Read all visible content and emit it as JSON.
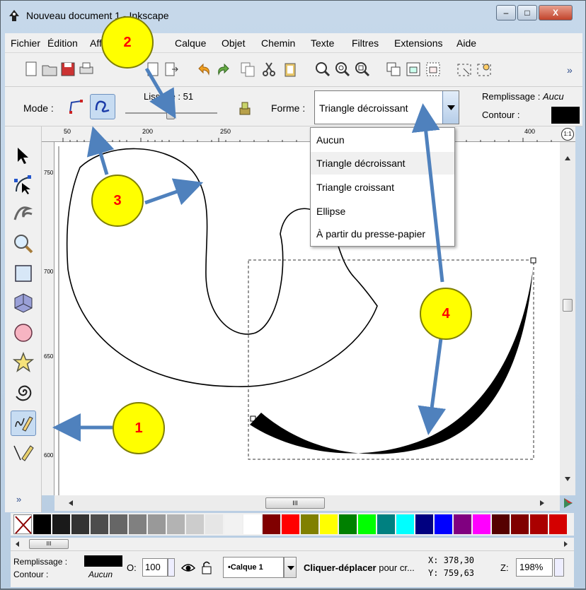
{
  "window": {
    "title": "Nouveau document 1 - Inkscape",
    "controls": {
      "minimize": "‒",
      "maximize": "□",
      "close": "X"
    }
  },
  "menubar": [
    "Fichier",
    "Édition",
    "Affichage",
    "Calque",
    "Objet",
    "Chemin",
    "Texte",
    "Filtres",
    "Extensions",
    "Aide"
  ],
  "command_toolbar": {
    "icons": [
      "new-document-icon",
      "open-icon",
      "save-icon",
      "print-icon",
      "import-icon",
      "export-icon",
      "undo-icon",
      "redo-icon",
      "copy-icon",
      "cut-icon",
      "paste-icon",
      "zoom-selection-icon",
      "zoom-drawing-icon",
      "zoom-page-icon",
      "duplicate-icon",
      "group-icon",
      "ungroup-icon",
      "fill-stroke-icon",
      "preferences-icon"
    ],
    "overflow": "»"
  },
  "controls_bar": {
    "mode_label": "Mode :",
    "smoothing_label": "Lissage : 51",
    "smoothing_value": 51,
    "shape_label": "Forme :",
    "shape_selected": "Triangle décroissant",
    "fill_label": "Remplissage :",
    "fill_value": "Aucu",
    "stroke_label": "Contour :",
    "stroke_color": "#000000"
  },
  "shape_dropdown": {
    "options": [
      "Aucun",
      "Triangle décroissant",
      "Triangle croissant",
      "Ellipse",
      "À partir du presse-papier"
    ],
    "highlighted_index": 1
  },
  "ruler": {
    "top_ticks": [
      "50",
      "200",
      "250",
      "400"
    ],
    "left_ticks": [
      "750",
      "700",
      "650",
      "600"
    ]
  },
  "toolbox": [
    "selector-icon",
    "node-editor-icon",
    "tweak-icon",
    "zoom-icon",
    "rectangle-icon",
    "3d-box-icon",
    "ellipse-icon",
    "star-icon",
    "spiral-icon",
    "pencil-icon",
    "pen-icon"
  ],
  "toolbox_overflow": "»",
  "palette": {
    "colors": [
      "#000000",
      "#1a1a1a",
      "#333333",
      "#4d4d4d",
      "#666666",
      "#808080",
      "#999999",
      "#b3b3b3",
      "#cccccc",
      "#e6e6e6",
      "#f2f2f2",
      "#ffffff",
      "#800000",
      "#ff0000",
      "#808000",
      "#ffff00",
      "#008000",
      "#00ff00",
      "#008080",
      "#00ffff",
      "#000080",
      "#0000ff",
      "#800080",
      "#ff00ff",
      "#550000",
      "#800000",
      "#aa0000",
      "#d40000"
    ]
  },
  "statusbar": {
    "fill_label": "Remplissage :",
    "stroke_label": "Contour :",
    "stroke_value": "Aucun",
    "opacity_label": "O:",
    "opacity_value": "100",
    "layer_name": "•Calque 1",
    "message_bold": "Cliquer-déplacer",
    "message_rest": "pour cr...",
    "coord_x_label": "X:",
    "coord_x": "378,30",
    "coord_y_label": "Y:",
    "coord_y": "759,63",
    "zoom_label": "Z:",
    "zoom_value": "198%"
  },
  "hscroll_thumb": "III",
  "pscroll_thumb": "III",
  "callouts": [
    "1",
    "2",
    "3",
    "4"
  ],
  "colors": {
    "arrow": "#4f81bd",
    "callout_fill": "#ffff00",
    "callout_text": "#ff0000"
  }
}
